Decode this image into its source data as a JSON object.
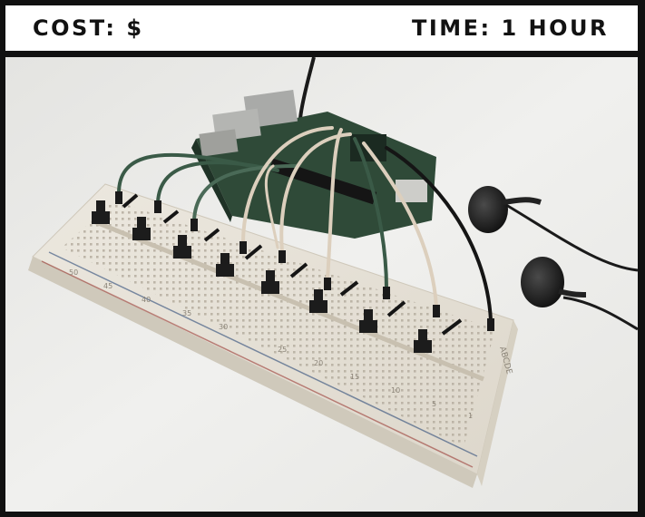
{
  "header": {
    "cost_label": "COST: $",
    "time_label": "TIME: 1 HOUR"
  },
  "photo": {
    "subject": "breadboard with push buttons wired to a single-board computer and earphones",
    "breadboard_numbers": [
      "30",
      "25",
      "20",
      "15",
      "10",
      "5",
      "1",
      "35",
      "40",
      "45",
      "50"
    ],
    "side_letters": "ABCDE"
  },
  "colors": {
    "frame": "#111111",
    "background": "#ececea",
    "board": "#e7e2d8",
    "pcb": "#2f4a38",
    "wire_green": "#3a5a47",
    "wire_cream": "#dccfbd",
    "wire_black": "#151515"
  }
}
